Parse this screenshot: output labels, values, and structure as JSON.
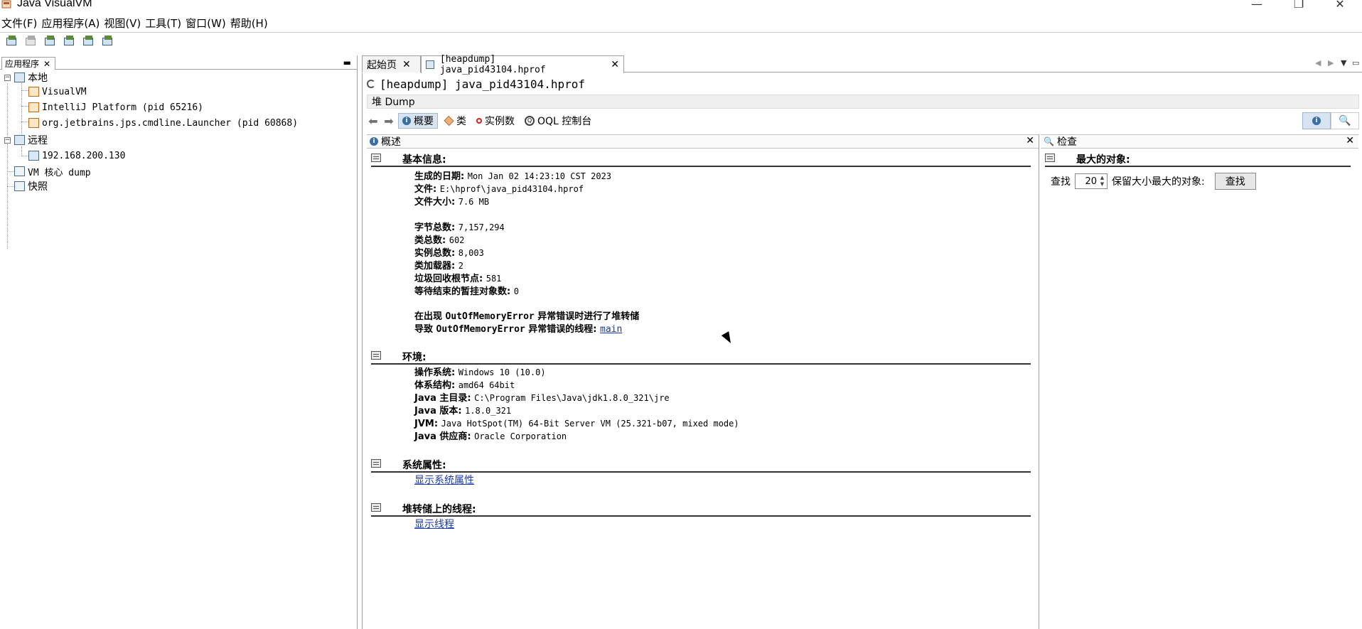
{
  "window": {
    "title": "Java VisualVM",
    "minimize": "—",
    "maximize": "❐",
    "close": "✕"
  },
  "menubar": {
    "items": [
      "文件(F)",
      "应用程序(A)",
      "视图(V)",
      "工具(T)",
      "窗口(W)",
      "帮助(H)"
    ]
  },
  "toolbar": {
    "icons": [
      "open-app-icon",
      "disabled-icon",
      "add-jmx-icon",
      "add-remote-host-icon",
      "load-snapshot-icon",
      "load-coredump-icon"
    ]
  },
  "left_panel": {
    "tab_label": "应用程序",
    "tree": {
      "local": "本地",
      "local_children": [
        "VisualVM",
        "IntelliJ Platform (pid 65216)",
        "org.jetbrains.jps.cmdline.Launcher (pid 60868)"
      ],
      "remote": "远程",
      "remote_children": [
        "192.168.200.130"
      ],
      "vm_core": "VM 核心 dump",
      "snapshots": "快照"
    }
  },
  "tabs": [
    {
      "label": "起始页"
    },
    {
      "label": "[heapdump] java_pid43104.hprof"
    }
  ],
  "doc": {
    "title": "[heapdump] java_pid43104.hprof",
    "heap_label": "堆 Dump",
    "views": {
      "summary": "概要",
      "classes": "类",
      "instances": "实例数",
      "oql": "OQL 控制台"
    }
  },
  "summary_panel": {
    "header": "概述",
    "basic_info": {
      "title": "基本信息:",
      "date_k": "生成的日期: ",
      "date_v": "Mon Jan 02 14:23:10 CST 2023",
      "file_k": "文件: ",
      "file_v": "E:\\hprof\\java_pid43104.hprof",
      "size_k": "文件大小: ",
      "size_v": "7.6 MB",
      "bytes_k": "字节总数: ",
      "bytes_v": "7,157,294",
      "classes_k": "类总数: ",
      "classes_v": "602",
      "instances_k": "实例总数: ",
      "instances_v": "8,003",
      "loaders_k": "类加载器: ",
      "loaders_v": "2",
      "gcroots_k": "垃圾回收根节点: ",
      "gcroots_v": "581",
      "pending_k": "等待结束的暂挂对象数: ",
      "pending_v": "0",
      "oome_1a": "在出现 ",
      "oome_1b": "OutOfMemoryError",
      "oome_1c": " 异常错误时进行了堆转储",
      "oome_2a": "导致 ",
      "oome_2b": "OutOfMemoryError",
      "oome_2c": " 异常错误的线程: ",
      "oome_thread": "main"
    },
    "environment": {
      "title": "环境:",
      "os_k": "操作系统: ",
      "os_v": "Windows 10 (10.0)",
      "arch_k": "体系结构: ",
      "arch_v": "amd64 64bit",
      "home_k": "Java 主目录: ",
      "home_v": "C:\\Program Files\\Java\\jdk1.8.0_321\\jre",
      "ver_k": "Java 版本: ",
      "ver_v": "1.8.0_321",
      "jvm_k": "JVM: ",
      "jvm_v": "Java HotSpot(TM) 64-Bit Server VM (25.321-b07, mixed mode)",
      "vendor_k": "Java 供应商: ",
      "vendor_v": "Oracle Corporation"
    },
    "sysprops": {
      "title": "系统属性:",
      "link": "显示系统属性"
    },
    "threads": {
      "title": "堆转储上的线程:",
      "link": "显示线程"
    }
  },
  "inspect_panel": {
    "header": "检查",
    "title": "最大的对象:",
    "find_label": "查找",
    "count": "20",
    "retained_label": "保留大小最大的对象:",
    "find_button": "查找"
  }
}
